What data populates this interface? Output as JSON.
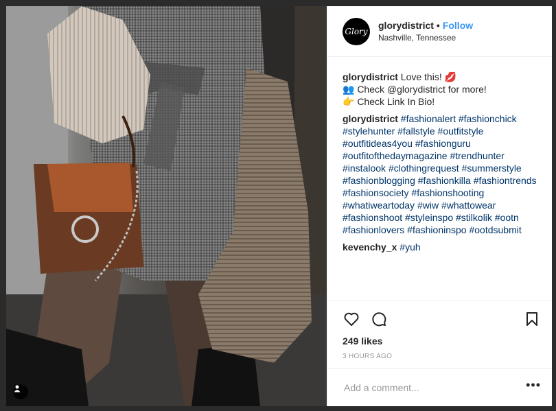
{
  "post": {
    "username": "glorydistrict",
    "avatar_text": "Glory",
    "follow_label": "Follow",
    "separator": "•",
    "location": "Nashville, Tennessee"
  },
  "comments": [
    {
      "username": "glorydistrict",
      "lines": [
        "Love this! 💋",
        "👥 Check @glorydistrict for more!",
        "👉 Check Link In Bio!"
      ]
    },
    {
      "username": "glorydistrict",
      "hashtags": [
        "#fashionalert",
        "#fashionchick",
        "#stylehunter",
        "#fallstyle",
        "#outfitstyle",
        "#outfitideas4you",
        "#fashionguru",
        "#outfitofthedaymagazine",
        "#trendhunter",
        "#instalook",
        "#clothingrequest",
        "#summerstyle",
        "#fashionblogging",
        "#fashionkilla",
        "#fashiontrends",
        "#fashionsociety",
        "#fashionshooting",
        "#whatiweartoday",
        "#wiw",
        "#whattowear",
        "#fashionshoot",
        "#styleinspo",
        "#stilkolik",
        "#ootn",
        "#fashionlovers",
        "#fashioninspo",
        "#ootdsubmit"
      ]
    },
    {
      "username": "kevenchy_x",
      "hashtags": [
        "#yuh"
      ]
    }
  ],
  "icons": {
    "like": "heart-icon",
    "comment": "comment-icon",
    "save": "bookmark-icon",
    "tagged": "user-tag-icon",
    "more": "more-options-icon"
  },
  "likes_text": "249 likes",
  "time_text": "3 HOURS AGO",
  "add_comment": {
    "placeholder": "Add a comment...",
    "more_label": "•••"
  },
  "colors": {
    "link": "#3897f0",
    "hashtag": "#003569",
    "muted": "#999999",
    "text": "#262626"
  }
}
